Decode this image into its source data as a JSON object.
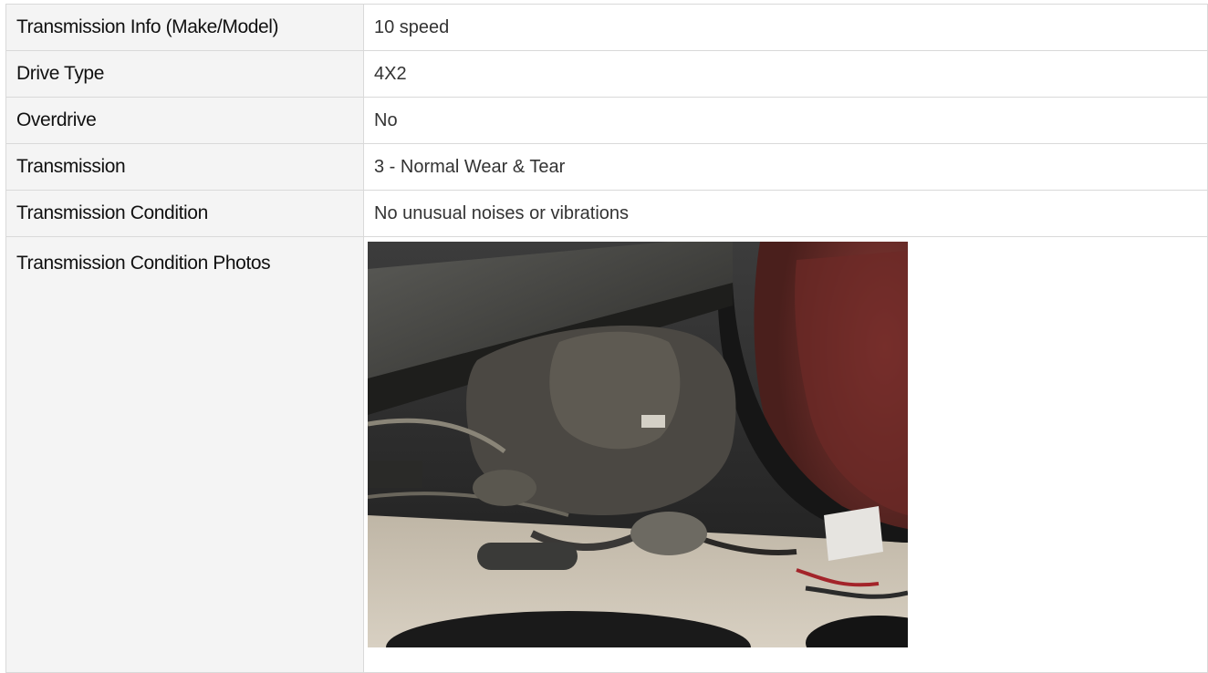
{
  "rows": [
    {
      "label": "Transmission Info (Make/Model)",
      "value": "10 speed"
    },
    {
      "label": "Drive Type",
      "value": "4X2"
    },
    {
      "label": "Overdrive",
      "value": "No"
    },
    {
      "label": "Transmission",
      "value": "3 - Normal Wear & Tear"
    },
    {
      "label": "Transmission Condition",
      "value": "No unusual noises or vibrations"
    }
  ],
  "photos_row": {
    "label": "Transmission Condition Photos",
    "photo_icon": "vehicle-undercarriage-photo"
  },
  "colors": {
    "label_bg": "#f4f4f4",
    "border": "#d9d9d9",
    "label_text": "#111111",
    "value_text": "#333333"
  }
}
